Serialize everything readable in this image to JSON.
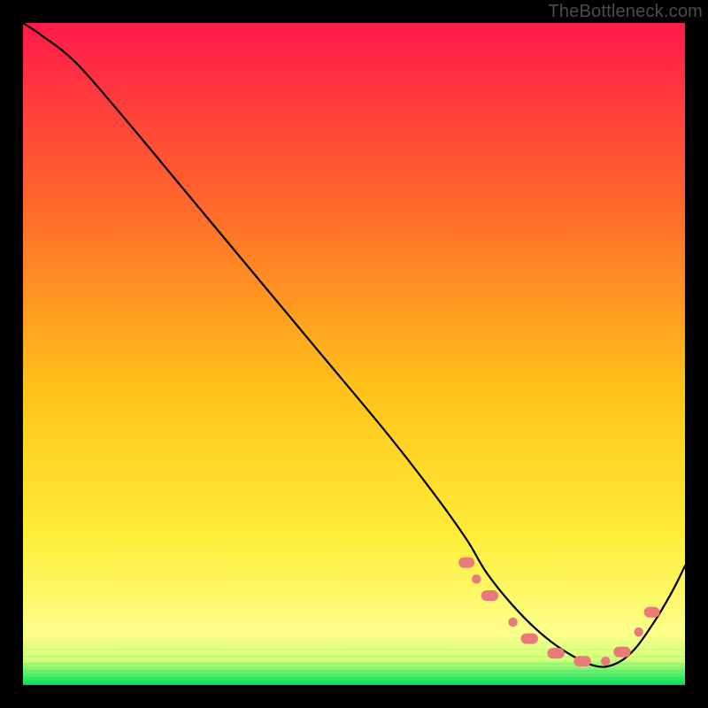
{
  "watermark": "TheBottleneck.com",
  "chart_data": {
    "type": "line",
    "title": "",
    "xlabel": "",
    "ylabel": "",
    "xlim": [
      0,
      100
    ],
    "ylim": [
      0,
      100
    ],
    "grid": false,
    "legend": false,
    "background_gradient": {
      "top": "#ff1a4a",
      "mid1": "#ff7a2a",
      "mid2": "#ffe02a",
      "mid3": "#ffff66",
      "bottom_band": "#00e060",
      "band_start_pct": 96
    },
    "series": [
      {
        "name": "curve",
        "color": "#000000",
        "x": [
          0,
          3,
          8,
          15,
          25,
          35,
          45,
          55,
          62,
          67,
          70,
          74,
          78,
          82,
          86,
          89,
          92,
          95,
          98,
          100
        ],
        "y": [
          100,
          98,
          94,
          86,
          74,
          62,
          50,
          38,
          29,
          22,
          17,
          12,
          8,
          5,
          3,
          3,
          5,
          9,
          14,
          18
        ]
      }
    ],
    "markers": {
      "name": "valley-dots",
      "color": "#e97a7a",
      "shape": "rounded",
      "points": [
        {
          "x": 67,
          "y": 18.5,
          "w": 2.4,
          "h": 1.6
        },
        {
          "x": 68.5,
          "y": 16,
          "w": 1.4,
          "h": 1.4
        },
        {
          "x": 70.5,
          "y": 13.5,
          "w": 2.6,
          "h": 1.6
        },
        {
          "x": 74,
          "y": 9.5,
          "w": 1.4,
          "h": 1.4
        },
        {
          "x": 76.5,
          "y": 7,
          "w": 2.6,
          "h": 1.6
        },
        {
          "x": 80.5,
          "y": 4.8,
          "w": 2.6,
          "h": 1.6
        },
        {
          "x": 84.5,
          "y": 3.6,
          "w": 2.6,
          "h": 1.6
        },
        {
          "x": 88,
          "y": 3.6,
          "w": 1.4,
          "h": 1.4
        },
        {
          "x": 90.5,
          "y": 5,
          "w": 2.6,
          "h": 1.6
        },
        {
          "x": 93,
          "y": 8,
          "w": 1.4,
          "h": 1.4
        },
        {
          "x": 95,
          "y": 11,
          "w": 2.4,
          "h": 1.6
        }
      ]
    }
  }
}
